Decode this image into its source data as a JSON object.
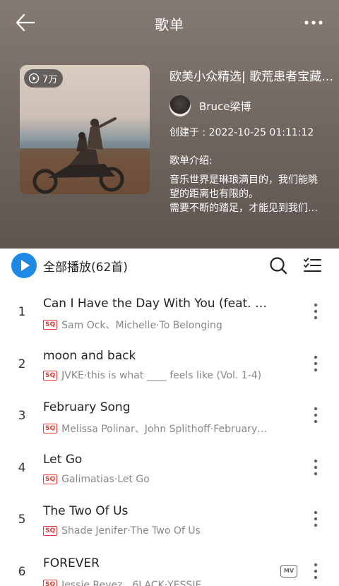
{
  "header": {
    "title": "歌单",
    "play_count": "7万",
    "playlist_name": "欧美小众精选| 歌荒患者宝藏…",
    "creator_name": "Bruce梁博",
    "created_at": "创建于 : 2022-10-25 01:11:12",
    "intro_label": "歌单介绍:",
    "intro_lines": [
      "音乐世界是琳琅满目的，我们能眺",
      "望的距离也有限的。",
      "需要不断的踏足，才能见到我们…"
    ]
  },
  "playall": {
    "label": "全部播放(62首)"
  },
  "songs": [
    {
      "index": "1",
      "title": "Can I Have the Day With You (feat. M…",
      "quality": "SQ",
      "artist": "Sam Ock、Michelle·To Belonging",
      "has_mv": false
    },
    {
      "index": "2",
      "title": "moon and back",
      "quality": "SQ",
      "artist": "JVKE·this is what ____ feels like (Vol. 1-4)",
      "has_mv": false
    },
    {
      "index": "3",
      "title": "February Song",
      "quality": "SQ",
      "artist": "Melissa Polinar、John Splithoff·February…",
      "has_mv": false
    },
    {
      "index": "4",
      "title": "Let Go",
      "quality": "SQ",
      "artist": "Galimatias·Let Go",
      "has_mv": false
    },
    {
      "index": "5",
      "title": "The Two Of Us",
      "quality": "SQ",
      "artist": "Shade Jenifer·The Two Of Us",
      "has_mv": false
    },
    {
      "index": "6",
      "title": "FOREVER",
      "quality": "SQ",
      "artist": "Jessie Reyez、6LACK·YESSIE",
      "has_mv": true,
      "mv_label": "MV"
    }
  ],
  "colors": {
    "accent": "#1e88e5",
    "sq_badge": "#e53935",
    "header_bg": "#6f655f"
  }
}
